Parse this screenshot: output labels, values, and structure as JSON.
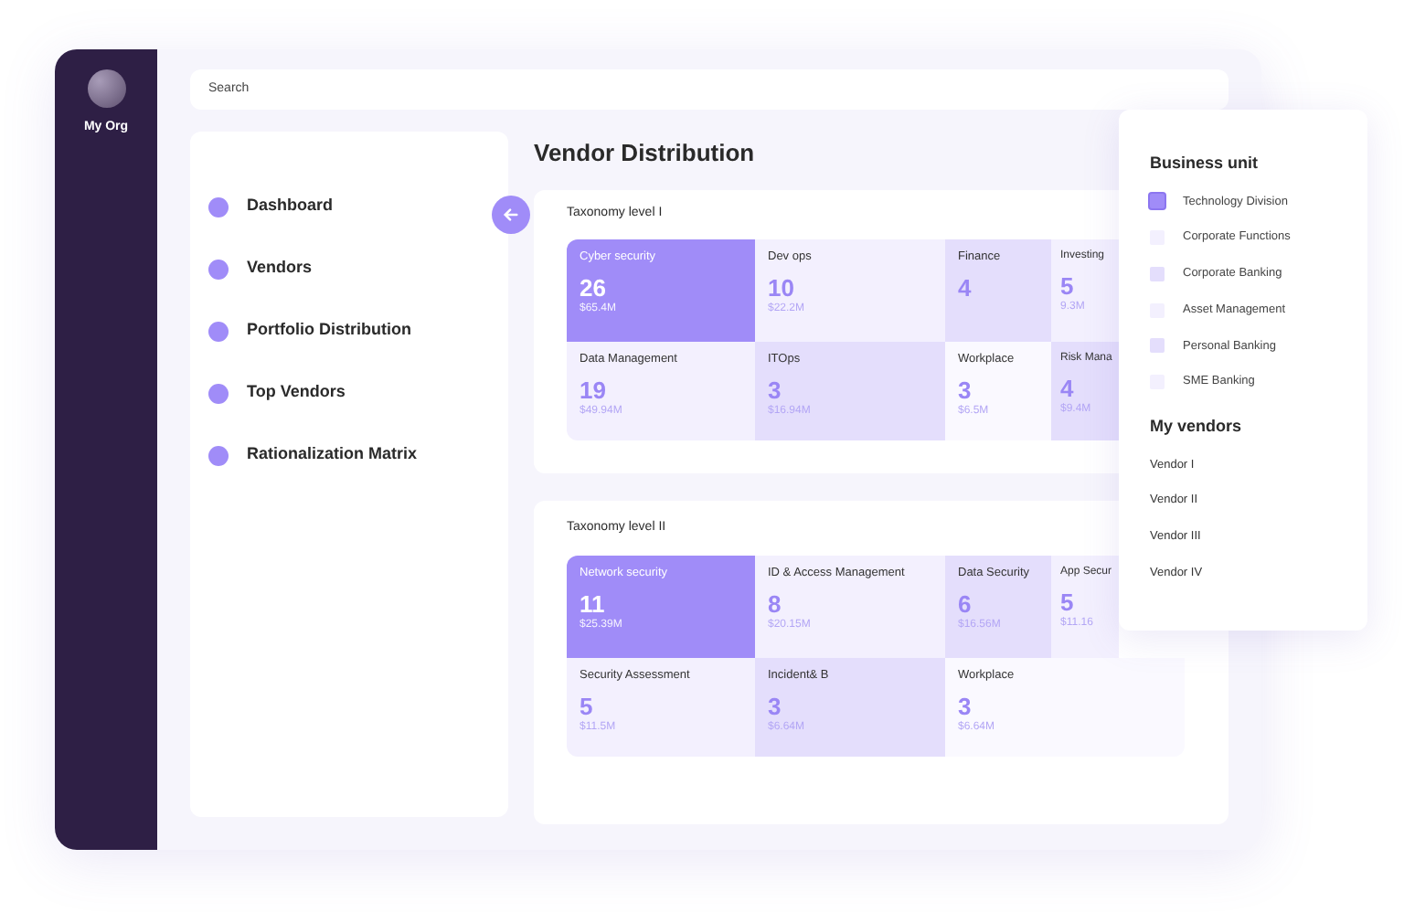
{
  "org": {
    "name": "My Org"
  },
  "search": {
    "placeholder": "Search"
  },
  "nav": [
    {
      "label": "Dashboard"
    },
    {
      "label": "Vendors"
    },
    {
      "label": "Portfolio Distribution"
    },
    {
      "label": "Top Vendors"
    },
    {
      "label": "Rationalization Matrix"
    }
  ],
  "title": "Vendor Distribution",
  "panels": [
    {
      "title": "Taxonomy level I",
      "tiles": [
        {
          "name": "Cyber security",
          "count": "26",
          "amount": "$65.4M",
          "color": "#a08cf8"
        },
        {
          "name": "Dev ops",
          "count": "10",
          "amount": "$22.2M",
          "color": "#f3f0fe"
        },
        {
          "name": "Finance",
          "count": "4",
          "color": "#e4defc"
        },
        {
          "name": "Investing",
          "count": "5",
          "amount": "9.3M",
          "color": "#f3f0fe"
        },
        {
          "name": "Data Management",
          "count": "19",
          "amount": "$49.94M",
          "color": "#f3f0fe"
        },
        {
          "name": "ITOps",
          "count": "3",
          "amount": "$16.94M",
          "color": "#e4defc"
        },
        {
          "name": "Workplace",
          "count": "3",
          "amount": "$6.5M",
          "color": "#faf9ff"
        },
        {
          "name": "Risk Mana",
          "count": "4",
          "amount": "$9.4M",
          "color": "#e4defc"
        }
      ]
    },
    {
      "title": "Taxonomy level II",
      "tiles": [
        {
          "name": "Network security",
          "count": "11",
          "amount": "$25.39M",
          "color": "#a08cf8"
        },
        {
          "name": "ID & Access Management",
          "count": "8",
          "amount": "$20.15M",
          "color": "#f3f0fe"
        },
        {
          "name": "Data Security",
          "count": "6",
          "amount": "$16.56M",
          "color": "#e4defc"
        },
        {
          "name": "App Secur",
          "count": "5",
          "amount": "$11.16",
          "color": "#f3f0fe"
        },
        {
          "name": "Security Assessment",
          "count": "5",
          "amount": "$11.5M",
          "color": "#f3f0fe"
        },
        {
          "name": "Incident& B",
          "count": "3",
          "amount": "$6.64M",
          "color": "#e4defc"
        },
        {
          "name": "Workplace",
          "count": "3",
          "amount": "$6.64M",
          "color": "#faf9ff"
        }
      ]
    }
  ],
  "filters": {
    "title": "Business unit",
    "items": [
      {
        "label": "Technology Division",
        "checked": true,
        "color": "#a08cf8"
      },
      {
        "label": "Corporate Functions",
        "checked": false,
        "color": "#f3f0fe"
      },
      {
        "label": "Corporate Banking",
        "checked": false,
        "color": "#e4defc"
      },
      {
        "label": "Asset Management",
        "checked": false,
        "color": "#f3f0fe"
      },
      {
        "label": "Personal Banking",
        "checked": false,
        "color": "#e4defc"
      },
      {
        "label": "SME Banking",
        "checked": false,
        "color": "#f3f0fe"
      }
    ]
  },
  "vendors": {
    "title": "My vendors",
    "items": [
      "Vendor I",
      "Vendor II",
      "Vendor III",
      "Vendor IV"
    ]
  }
}
